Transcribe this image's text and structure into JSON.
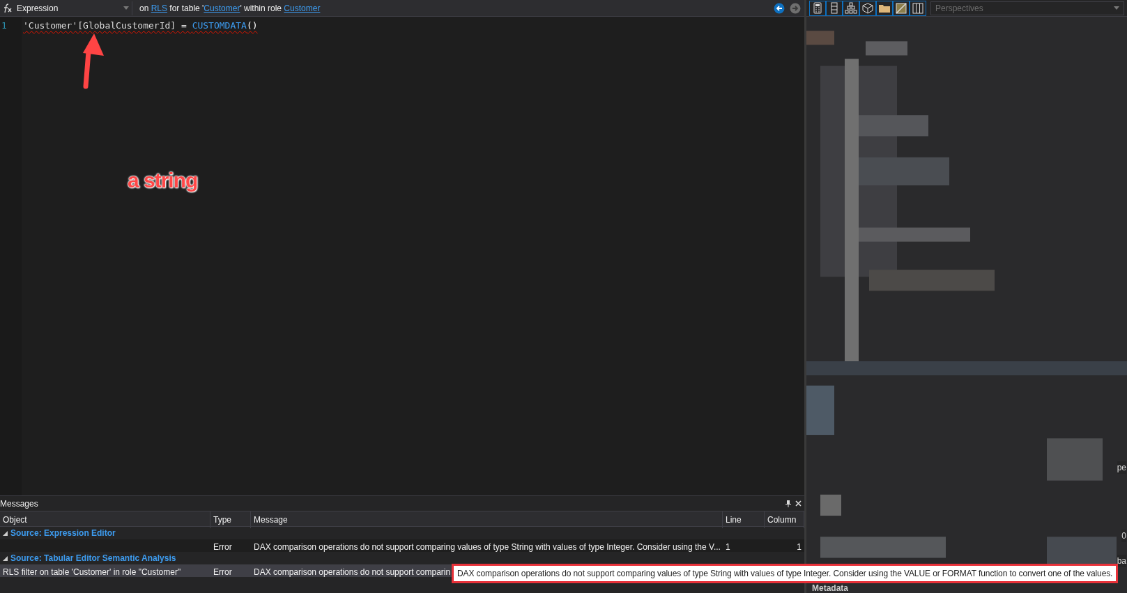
{
  "editor_bar": {
    "property": "Expression",
    "context": [
      {
        "kind": "text",
        "text": "on "
      },
      {
        "kind": "link",
        "text": "RLS"
      },
      {
        "kind": "text",
        "text": " for table '"
      },
      {
        "kind": "link",
        "text": "Customer"
      },
      {
        "kind": "text",
        "text": "' within role "
      },
      {
        "kind": "link",
        "text": "Customer"
      }
    ],
    "nav_buttons": [
      {
        "kind": "back",
        "disabled": false
      },
      {
        "kind": "forward",
        "disabled": true
      }
    ]
  },
  "code": {
    "line_number": "1",
    "error": true,
    "tokens": [
      {
        "kind": "plain",
        "text": "'Customer'[GlobalCustomerId] = "
      },
      {
        "kind": "function",
        "text": "CUSTOMDATA"
      },
      {
        "kind": "paren",
        "text": "()"
      }
    ]
  },
  "annotation": {
    "text": "a string"
  },
  "right_panel": {
    "perspectives": {
      "placeholder": "Perspectives"
    },
    "fragments": [
      "pe",
      "0",
      "ba"
    ],
    "section": "Metadata"
  },
  "messages": {
    "title": "Messages",
    "columns": [
      "Object",
      "Type",
      "Message",
      "Line",
      "Column"
    ],
    "groups": [
      {
        "source": "Source: Expression Editor",
        "expanded": true,
        "rows": [
          {
            "type": "Error",
            "message": "DAX comparison operations do not support comparing values of type String with values of type Integer. Consider using the V...",
            "line": "1",
            "column": "1",
            "selected": false
          }
        ]
      },
      {
        "source": "Source: Tabular Editor Semantic Analysis",
        "expanded": true,
        "rows": [
          {
            "object": "RLS filter on table 'Customer' in role \"Customer\"",
            "type": "Error",
            "message": "DAX comparison operations do not support comparin",
            "selected": true
          }
        ]
      }
    ],
    "tooltip": "DAX comparison operations do not support comparing values of type String with values of type Integer. Consider using the VALUE or FORMAT function to convert one of the values."
  }
}
